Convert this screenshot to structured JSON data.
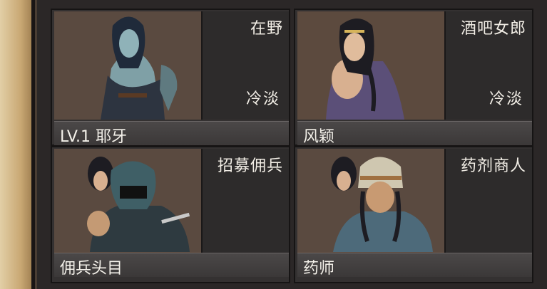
{
  "cards": [
    {
      "role": "在野",
      "mood": "冷淡",
      "name": "LV.1 耶牙"
    },
    {
      "role": "酒吧女郎",
      "mood": "冷淡",
      "name": "风颖"
    },
    {
      "role": "招募佣兵",
      "mood": "",
      "name": "佣兵头目"
    },
    {
      "role": "药剂商人",
      "mood": "",
      "name": "药师"
    }
  ]
}
